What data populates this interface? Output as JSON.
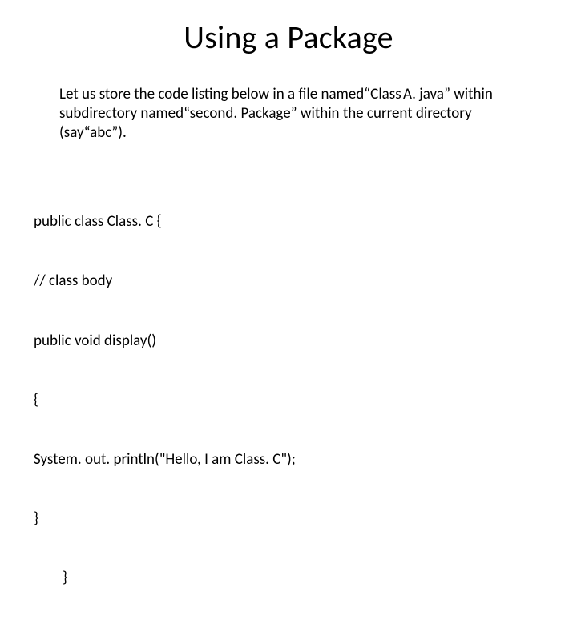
{
  "title": "Using a Package",
  "body": "Let us store the code listing below in a file named“Class A. java” within subdirectory named“second. Package” within the current directory (say“abc”).",
  "code": {
    "l1": "public class Class. C {",
    "l2": "// class body",
    "l3": "public void display()",
    "l4": "{",
    "l5": "System. out. println(\"Hello, I am Class. C\");",
    "l6": "}",
    "l7": "}"
  }
}
